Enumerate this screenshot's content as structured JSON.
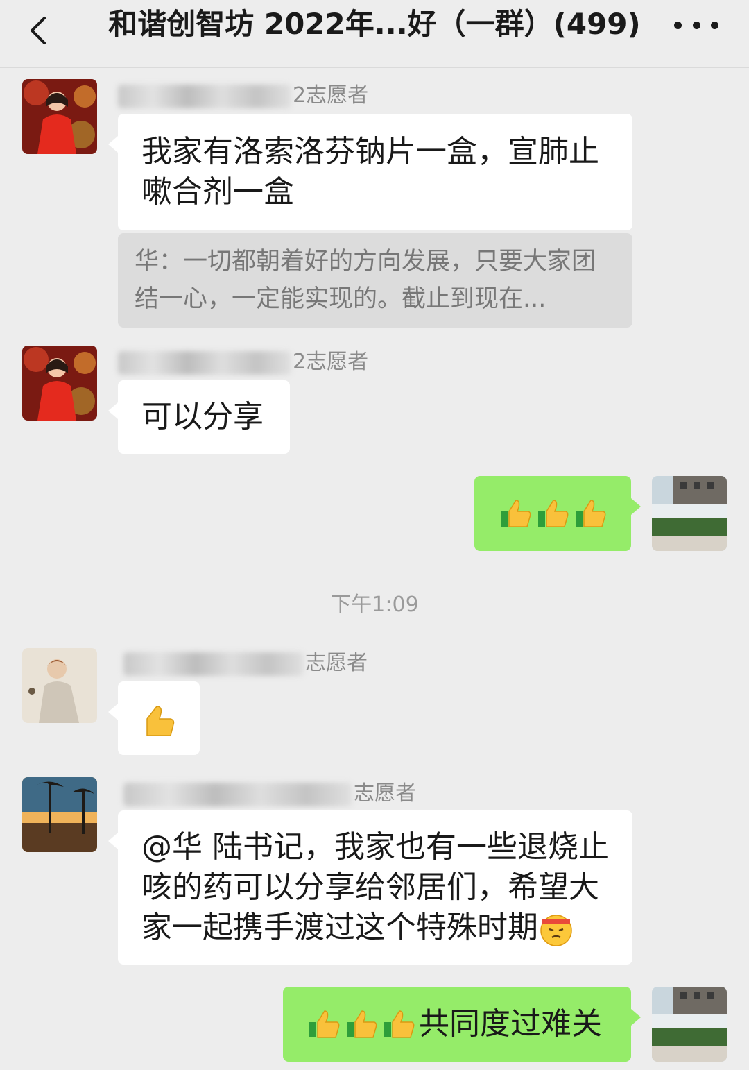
{
  "header": {
    "title": "和谐创智坊 2022年...好（一群）(499)"
  },
  "messages": {
    "m1": {
      "sender_suffix": "2志愿者",
      "text": "我家有洛索洛芬钠片一盒，宣肺止嗽合剂一盒",
      "quote": "华：一切都朝着好的方向发展，只要大家团结一心，一定能实现的。截止到现在..."
    },
    "m2": {
      "sender_suffix": "2志愿者",
      "text": "可以分享"
    },
    "m3": {
      "emoji": "thumbs-up x3"
    },
    "timestamp": "下午1:09",
    "m4": {
      "sender_suffix": "志愿者",
      "emoji": "thumbs-up"
    },
    "m5": {
      "sender_suffix": "志愿者",
      "text": "@华  陆书记，我家也有一些退烧止咳的药可以分享给邻居们，希望大家一起携手渡过这个特殊时期",
      "emoji": "determined-face"
    },
    "m6": {
      "text": "共同度过难关",
      "emoji": "thumbs-up x3"
    }
  },
  "colors": {
    "background": "#ededed",
    "green_bubble": "#95ec69",
    "white_bubble": "#ffffff",
    "quote_bg": "#dcdcdc"
  },
  "icons": [
    "back-arrow-icon",
    "more-dots-icon",
    "thumbs-up-icon",
    "determined-face-icon"
  ]
}
